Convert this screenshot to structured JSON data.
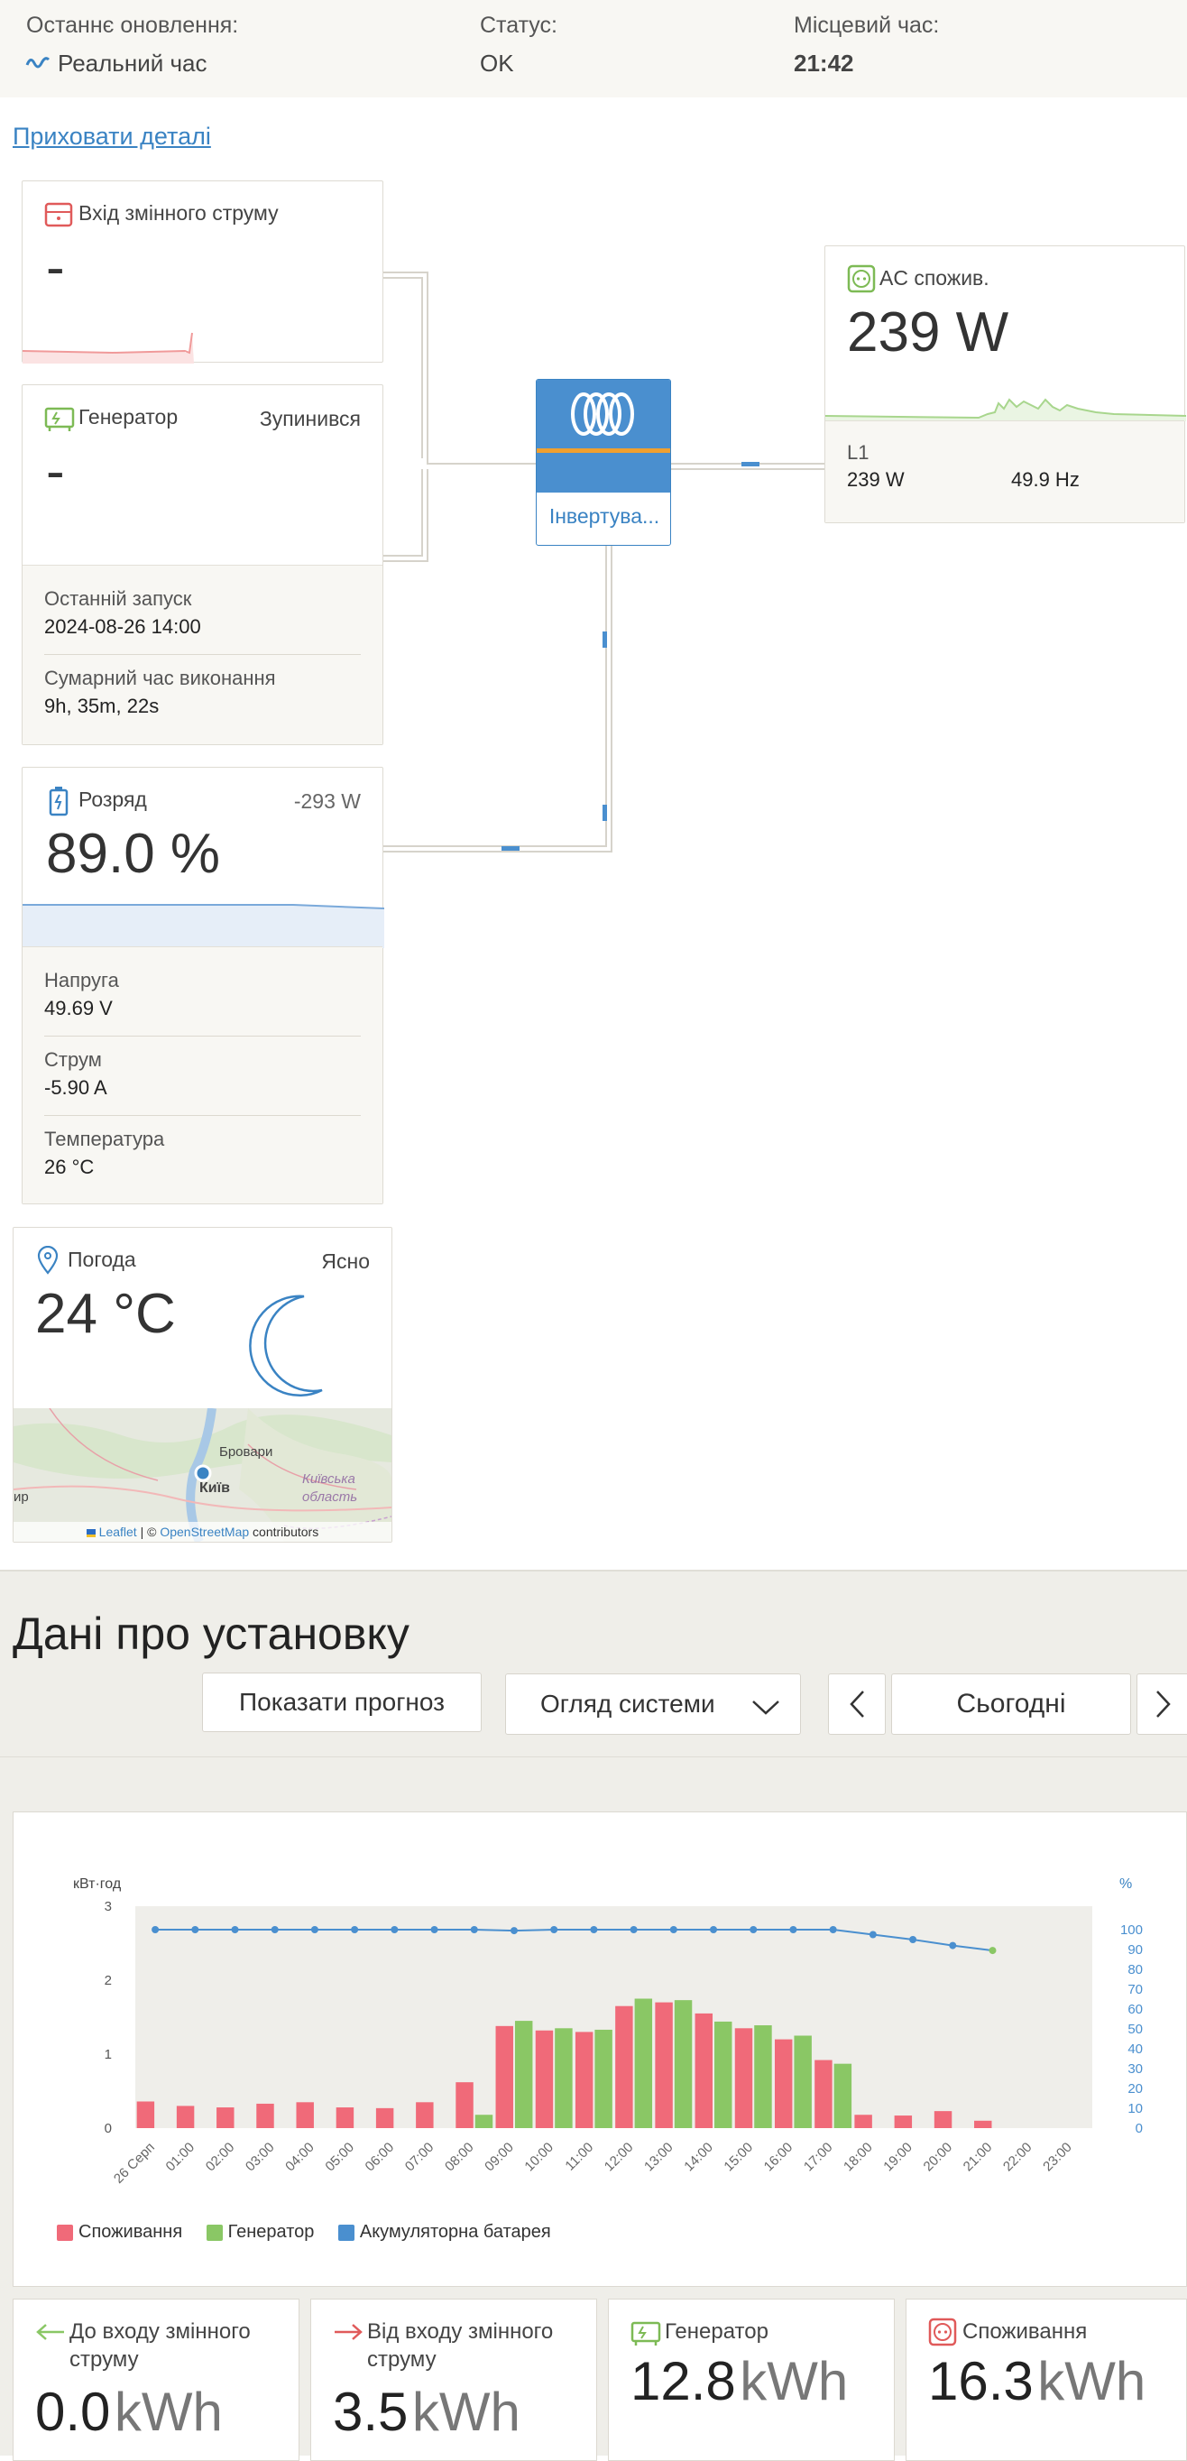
{
  "status_bar": {
    "last_update_label": "Останнє оновлення:",
    "last_update_value": "Реальний час",
    "status_label": "Статус:",
    "status_value": "OK",
    "local_time_label": "Місцевий час:",
    "local_time_value": "21:42"
  },
  "hide_details_link": "Приховати деталі",
  "ac_input": {
    "title": "Вхід змінного струму",
    "value": "-"
  },
  "generator": {
    "title": "Генератор",
    "state": "Зупинився",
    "value": "-",
    "last_start_label": "Останній запуск",
    "last_start_value": "2024-08-26 14:00",
    "total_runtime_label": "Сумарний час виконання",
    "total_runtime_value": "9h, 35m, 22s"
  },
  "battery": {
    "title": "Розряд",
    "power": "-293 W",
    "value": "89.0 %",
    "soc_fraction": 0.89,
    "voltage_label": "Напруга",
    "voltage_value": "49.69 V",
    "current_label": "Струм",
    "current_value": "-5.90 A",
    "temperature_label": "Температура",
    "temperature_value": "26 °C"
  },
  "inverter": {
    "label": "Інвертува..."
  },
  "ac_loads": {
    "title": "AC спожив.",
    "value": "239 W",
    "phase_label": "L1",
    "phase_power": "239 W",
    "frequency": "49.9 Hz"
  },
  "weather": {
    "title": "Погода",
    "condition": "Ясно",
    "temperature": "24 °C",
    "map_city": "Київ",
    "map_town": "Бровари",
    "map_region_1": "Київська",
    "map_region_2": "область",
    "map_edge": "ир",
    "attribution_leaflet": "Leaflet",
    "attribution_sep": " | © ",
    "attribution_osm": "OpenStreetMap",
    "attribution_tail": " contributors"
  },
  "installation": {
    "title": "Дані про установку",
    "forecast_button": "Показати прогноз",
    "view_select": "Огляд системи",
    "date_label": "Сьогодні"
  },
  "chart_data": {
    "type": "bar",
    "ylabel_left": "кВт·год",
    "ylabel_right": "%",
    "left_ticks": [
      "0",
      "1",
      "2",
      "3"
    ],
    "right_ticks": [
      "0",
      "10",
      "20",
      "30",
      "40",
      "50",
      "60",
      "70",
      "80",
      "90",
      "100"
    ],
    "ylim_left": [
      0,
      3
    ],
    "ylim_right": [
      0,
      100
    ],
    "categories": [
      "26 Серп",
      "01:00",
      "02:00",
      "03:00",
      "04:00",
      "05:00",
      "06:00",
      "07:00",
      "08:00",
      "09:00",
      "10:00",
      "11:00",
      "12:00",
      "13:00",
      "14:00",
      "15:00",
      "16:00",
      "17:00",
      "18:00",
      "19:00",
      "20:00",
      "21:00",
      "22:00",
      "23:00"
    ],
    "series": [
      {
        "name": "Споживання",
        "color": "#f06a79",
        "values": [
          0.36,
          0.3,
          0.28,
          0.33,
          0.35,
          0.28,
          0.27,
          0.35,
          0.62,
          1.38,
          1.32,
          1.3,
          1.65,
          1.7,
          1.55,
          1.35,
          1.2,
          0.92,
          0.18,
          0.17,
          0.23,
          0.1,
          0,
          0
        ]
      },
      {
        "name": "Генератор",
        "color": "#8ac765",
        "values": [
          0,
          0,
          0,
          0,
          0,
          0,
          0,
          0,
          0.18,
          1.45,
          1.35,
          1.33,
          1.75,
          1.73,
          1.44,
          1.39,
          1.25,
          0.87,
          0,
          0,
          0,
          0,
          0,
          0
        ]
      },
      {
        "name": "Акумуляторна батарея",
        "color": "#4a8fcf",
        "axis": "right",
        "values": [
          100,
          100,
          100,
          100,
          100,
          100,
          100,
          100,
          100,
          99.5,
          100,
          100,
          100,
          100,
          100,
          100,
          100,
          100,
          97.5,
          95,
          92,
          89.5,
          null,
          null
        ]
      }
    ],
    "legend_position": "bottom-left"
  },
  "stats": [
    {
      "title": "До входу змінного струму",
      "value": "0.0",
      "unit": "kWh"
    },
    {
      "title": "Від входу змінного струму",
      "value": "3.5",
      "unit": "kWh"
    },
    {
      "title": "Генератор",
      "value": "12.8",
      "unit": "kWh"
    },
    {
      "title": "Споживання",
      "value": "16.3",
      "unit": "kWh"
    }
  ],
  "colors": {
    "accent_blue": "#3a83c3",
    "consumption_red": "#f06a79",
    "generator_green": "#8ac765",
    "battery_blue": "#4a8fcf",
    "inverter_orange": "#f0a030"
  }
}
